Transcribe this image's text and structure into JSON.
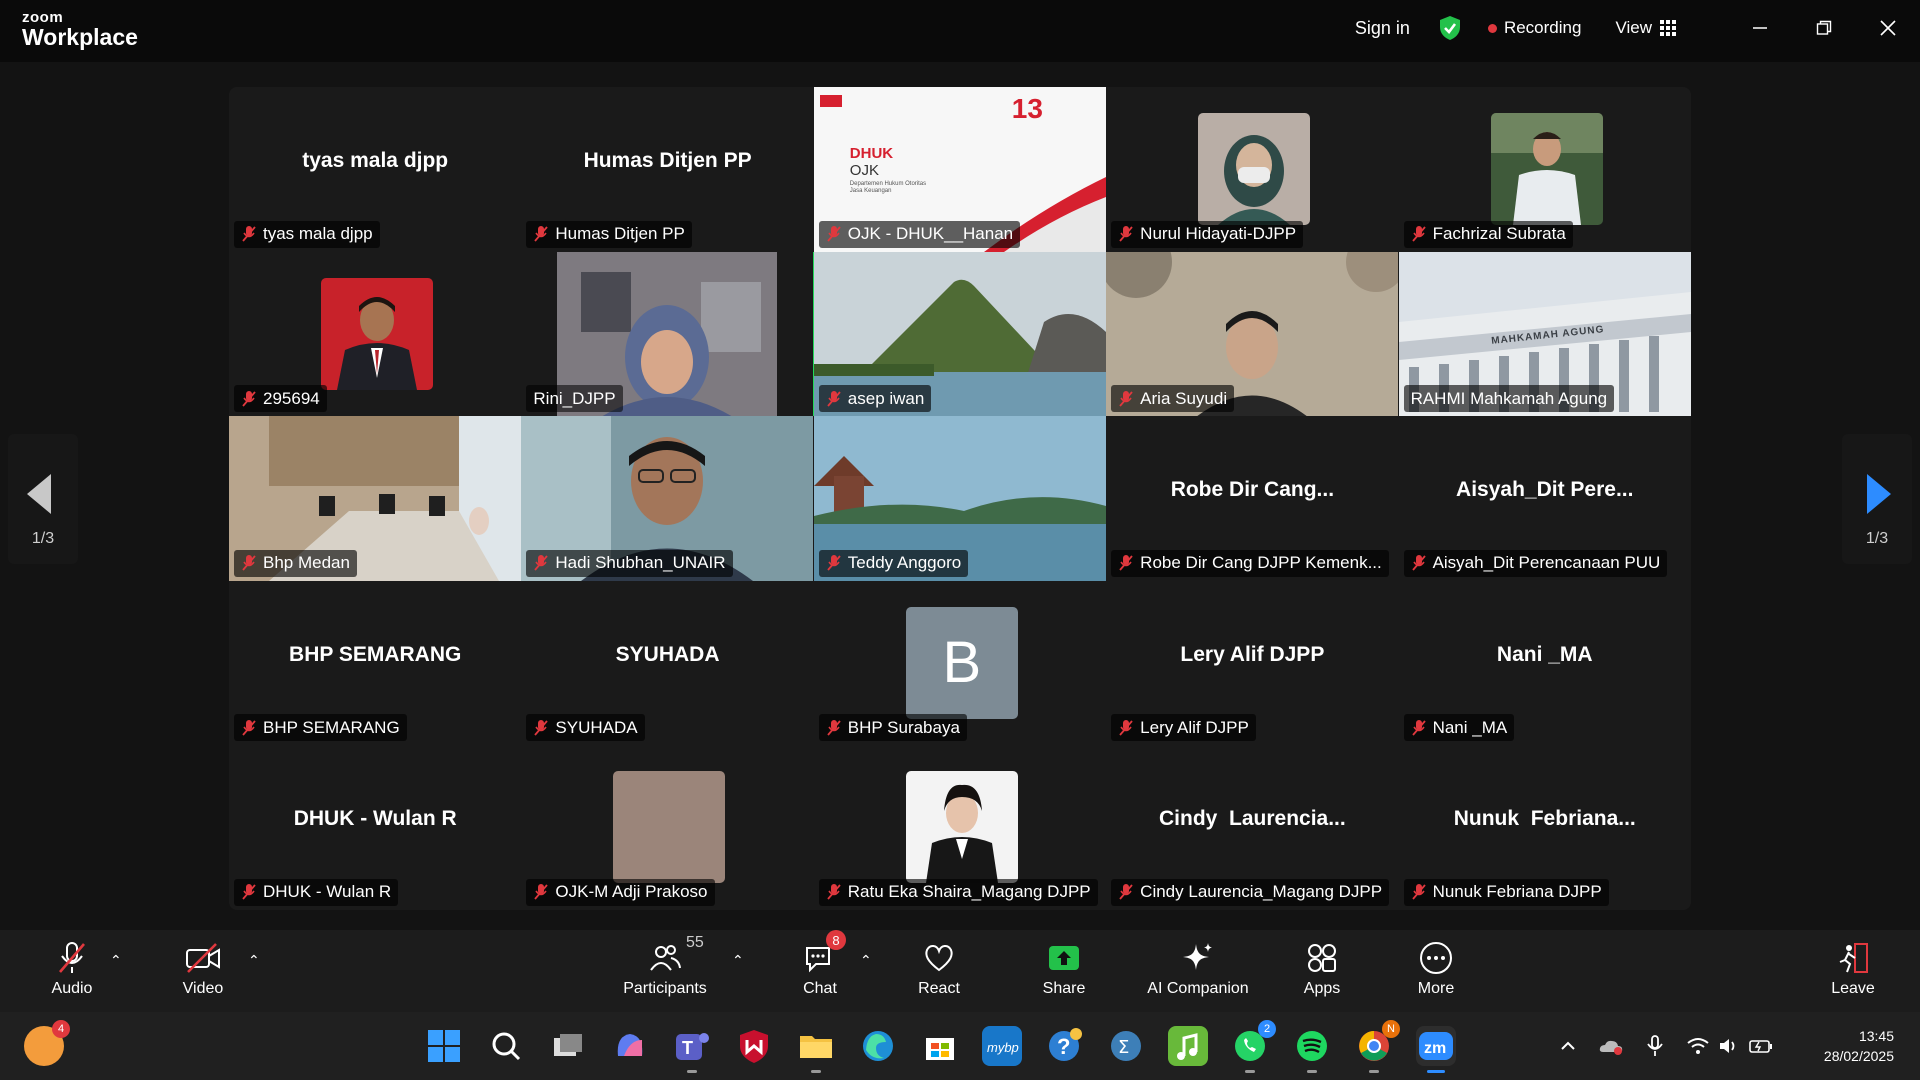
{
  "titlebar": {
    "brand_small": "zoom",
    "brand_big": "Workplace",
    "sign_in": "Sign in",
    "recording": "Recording",
    "view": "View"
  },
  "pager": {
    "left": "1/3",
    "right": "1/3"
  },
  "tiles": [
    {
      "center": "tyas mala djpp",
      "label": "tyas mala djpp"
    },
    {
      "center": "Humas Ditjen PP",
      "label": "Humas Ditjen PP"
    },
    {
      "label": "OJK - DHUK__Hanan",
      "slide_title": "DHUK",
      "slide_sub": "OJK",
      "slide_small": "Departemen Hukum Otoritas Jasa Keuangan",
      "slide_num": "13"
    },
    {
      "label": "Nurul Hidayati-DJPP"
    },
    {
      "label": "Fachrizal Subrata"
    },
    {
      "label": "295694"
    },
    {
      "label": "Rini_DJPP"
    },
    {
      "label": "asep iwan"
    },
    {
      "label": "Aria Suyudi"
    },
    {
      "label": "RAHMI Mahkamah Agung",
      "building_text": "MAHKAMAH AGUNG"
    },
    {
      "label": "Bhp Medan"
    },
    {
      "label": "Hadi Shubhan_UNAIR"
    },
    {
      "label": "Teddy Anggoro"
    },
    {
      "center": "Robe Dir Cang...",
      "label": "Robe Dir Cang DJPP Kemenk..."
    },
    {
      "center": "Aisyah_Dit Pere...",
      "label": "Aisyah_Dit Perencanaan PUU"
    },
    {
      "center": "BHP SEMARANG",
      "label": "BHP SEMARANG"
    },
    {
      "center": "SYUHADA",
      "label": "SYUHADA"
    },
    {
      "avatar_letter": "B",
      "label": "BHP Surabaya"
    },
    {
      "center": "Lery Alif DJPP",
      "label": "Lery Alif DJPP"
    },
    {
      "center": "Nani _MA",
      "label": "Nani _MA"
    },
    {
      "center": "DHUK - Wulan R",
      "label": "DHUK - Wulan R"
    },
    {
      "label": "OJK-M Adji Prakoso"
    },
    {
      "label": "Ratu Eka Shaira_Magang DJPP"
    },
    {
      "center": "Cindy  Laurencia...",
      "label": "Cindy Laurencia_Magang DJPP"
    },
    {
      "center": "Nunuk  Febriana...",
      "label": "Nunuk Febriana DJPP"
    }
  ],
  "toolbar": {
    "audio": "Audio",
    "video": "Video",
    "participants": "Participants",
    "participants_count": "55",
    "chat": "Chat",
    "chat_badge": "8",
    "react": "React",
    "share": "Share",
    "ai": "AI Companion",
    "apps": "Apps",
    "more": "More",
    "leave": "Leave"
  },
  "taskbar": {
    "widget_badge": "4",
    "whatsapp_badge": "2",
    "chrome_badge": "N",
    "time": "13:45",
    "date": "28/02/2025"
  }
}
